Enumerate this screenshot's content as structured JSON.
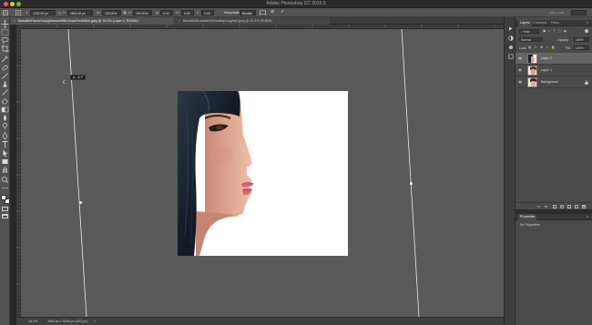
{
  "window": {
    "title": "Adobe Photoshop CC 2015.5",
    "traffic_colors": [
      "#ee5c55",
      "#f5bd35",
      "#5ac543"
    ]
  },
  "options_bar": {
    "x_value": "1200.00 px",
    "y_value": "1800.00 px",
    "w_value": "100.00%",
    "h_value": "100.00%",
    "angle": "0.00",
    "h_skew": "0.00",
    "v_skew": "0.00",
    "interpolation_label": "Interpolation:",
    "interpolation_value": "Bicubic",
    "commit_label": "Edit Local"
  },
  "document_tabs": [
    {
      "label": "BeautifulFacesYoungWomanWithCleanFreshSkin.jpeg @ 16.3% (Layer 2, RGB/8) *",
      "active": true
    },
    {
      "label": "BeautifulBrunetteGirlHealthyLongHair.jpeg @ 33.3% (RGB/8)",
      "active": false
    }
  ],
  "tools": [
    "move-tool-icon",
    "marquee-tool-icon",
    "lasso-tool-icon",
    "crop-tool-icon",
    "eyedropper-tool-icon",
    "healing-brush-icon",
    "brush-tool-icon",
    "clone-stamp-icon",
    "history-brush-icon",
    "eraser-tool-icon",
    "gradient-tool-icon",
    "blur-tool-icon",
    "dodge-tool-icon",
    "pen-tool-icon",
    "type-tool-icon",
    "path-selection-icon",
    "rectangle-tool-icon",
    "hand-tool-icon",
    "zoom-tool-icon",
    "more-tools-icon"
  ],
  "transform_tooltip": "∠: -4.1°",
  "status_bar": {
    "zoom": "16.3%",
    "doc_size": "Doc: 24.0M/72.0M",
    "dims": "3000 px x 3000 px (300 ppi)"
  },
  "layers_panel": {
    "tabs": [
      "Layers",
      "Channels",
      "Paths"
    ],
    "kind_label": "Kind",
    "blend_mode": "Normal",
    "opacity_label": "Opacity:",
    "opacity_value": "100%",
    "lock_label": "Lock:",
    "fill_label": "Fill:",
    "fill_value": "100%",
    "layers": [
      {
        "name": "Layer 2",
        "selected": true
      },
      {
        "name": "Layer 1",
        "selected": false
      },
      {
        "name": "Background",
        "selected": false
      }
    ]
  },
  "properties_panel": {
    "title": "Properties",
    "empty_text": "No Properties"
  },
  "colors": {
    "skin": "#d9a08c",
    "hair": "#1c2530",
    "lips": "#c95c73",
    "canvas_bg": "#595959",
    "selected_layer": "#646464"
  }
}
